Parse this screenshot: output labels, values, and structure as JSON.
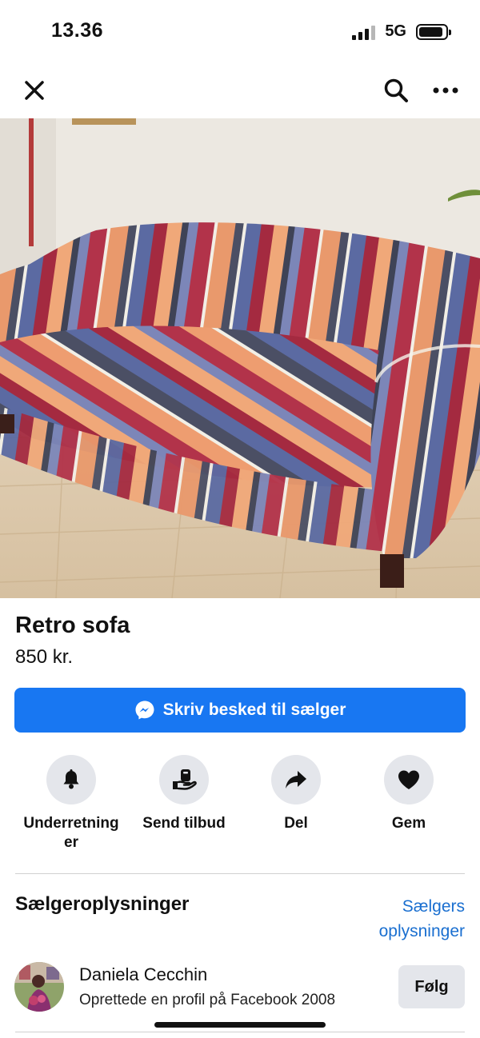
{
  "status_bar": {
    "time": "13.36",
    "network": "5G",
    "signal_icon": "signal-bars-icon",
    "battery_icon": "battery-icon",
    "signal_level": 0.75,
    "battery_level": 0.9
  },
  "nav": {
    "close_icon": "close-icon",
    "search_icon": "search-icon",
    "more_icon": "more-dots-icon"
  },
  "photo": {
    "pages": 4,
    "current_page": 2
  },
  "listing": {
    "title": "Retro sofa",
    "price": "850 kr."
  },
  "message_button": {
    "label": "Skriv besked til sælger",
    "icon": "messenger-icon",
    "color": "#1877f2"
  },
  "actions": [
    {
      "label": "Underretninger",
      "icon": "bell-icon"
    },
    {
      "label": "Send tilbud",
      "icon": "offer-hand-icon"
    },
    {
      "label": "Del",
      "icon": "share-arrow-icon"
    },
    {
      "label": "Gem",
      "icon": "heart-icon"
    }
  ],
  "seller_section": {
    "heading": "Sælgeroplysninger",
    "link": "Sælgers oplysninger",
    "name": "Daniela Cecchin",
    "subtitle": "Oprettede en profil på Facebook 2008",
    "follow": "Følg",
    "link_color": "#1a6fd0"
  }
}
